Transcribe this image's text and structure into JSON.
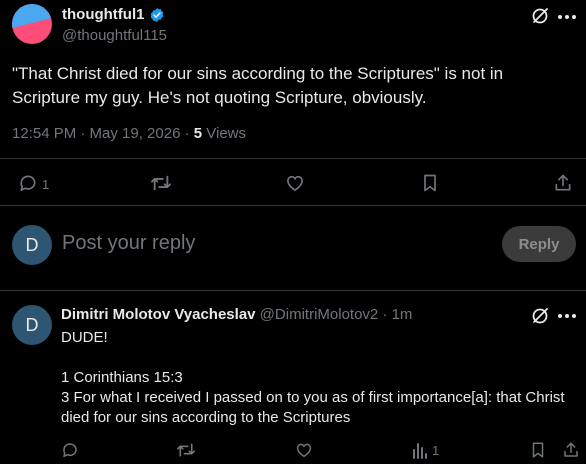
{
  "tweet": {
    "author_name": "thoughtful1",
    "handle": "@thoughtful115",
    "text_line1": "\"That Christ died for our sins according to the Scriptures\" is not in",
    "text_line2": "Scripture my guy. He's not quoting Scripture, obviously.",
    "time": "12:54 PM · May 19, 2026 · ",
    "views_count": "5",
    "views_label": " Views",
    "reply_count": "1"
  },
  "composer": {
    "avatar_letter": "D",
    "placeholder": "Post your reply",
    "reply_button": "Reply"
  },
  "comment": {
    "avatar_letter": "D",
    "name": "Dimitri Molotov Vyacheslav",
    "handle_time": " @DimitriMolotov2 · 1m",
    "line1": "DUDE!",
    "line2": "",
    "line3": "1 Corinthians 15:3",
    "line4": "3 For what I received I passed on to you as of first importance[a]: that Christ",
    "line5": "died for our sins according to the Scriptures",
    "views_count": "1"
  },
  "colors": {
    "background": "#000000",
    "text": "#e7e9ea",
    "muted": "#71767b",
    "divider": "#2f3336",
    "verified": "#1d9bf0",
    "avatar_bg": "#2e5673"
  },
  "icons": [
    "verified-badge-icon",
    "grok-icon",
    "more-icon",
    "reply-icon",
    "repost-icon",
    "like-icon",
    "bookmark-icon",
    "share-icon",
    "views-icon"
  ]
}
